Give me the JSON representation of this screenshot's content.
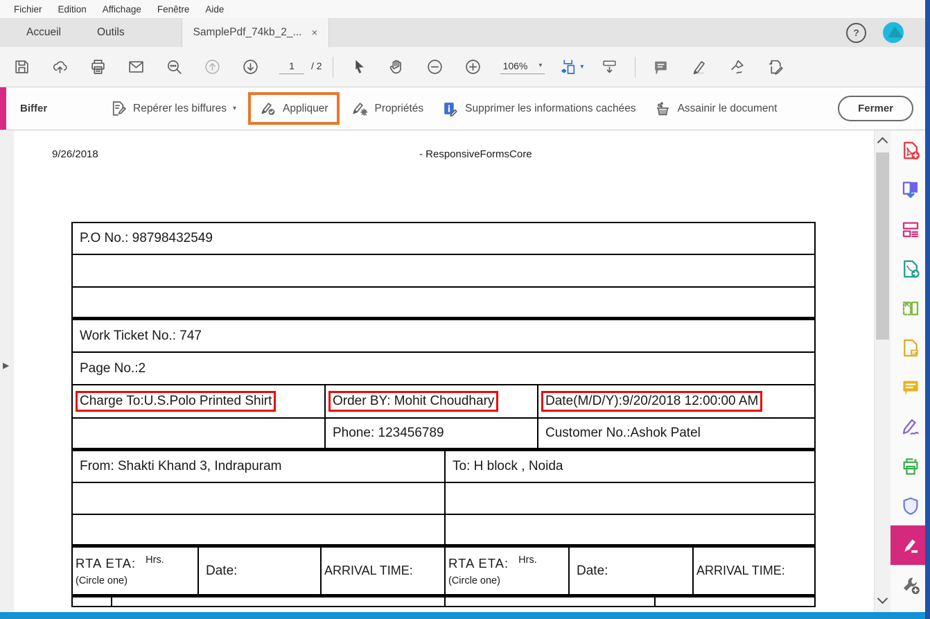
{
  "menu_bar": {
    "items": [
      "Fichier",
      "Edition",
      "Affichage",
      "Fenêtre",
      "Aide"
    ]
  },
  "tab_bar": {
    "tabs": [
      {
        "label": "Accueil"
      },
      {
        "label": "Outils"
      },
      {
        "label": "SamplePdf_74kb_2_...",
        "active": true
      }
    ],
    "close_glyph": "×",
    "help_glyph": "?"
  },
  "toolbar": {
    "page_current": "1",
    "page_separator": "/ 2",
    "zoom_value": "106%"
  },
  "redact_bar": {
    "title": "Biffer",
    "mark_label": "Repérer les biffures",
    "apply_label": "Appliquer",
    "properties_label": "Propriétés",
    "remove_hidden_label": "Supprimer les informations cachées",
    "sanitize_label": "Assainir le document",
    "close_button": "Fermer"
  },
  "document": {
    "date_header": "9/26/2018",
    "title_header": "- ResponsiveFormsCore",
    "table": {
      "po_no": "P.O No.: 98798432549",
      "work_ticket": "Work Ticket No.: 747",
      "page_no": "Page No.:2",
      "charge_to": "Charge To:U.S.Polo Printed Shirt",
      "order_by": "Order BY: Mohit Choudhary",
      "date_field": "Date(M/D/Y):9/20/2018 12:00:00 AM",
      "phone": "Phone: 123456789",
      "customer_no": "Customer No.:Ashok Patel",
      "from": "From: Shakti Khand 3, Indrapuram",
      "to": "To: H block , Noida",
      "rta_eta": "RTA  ETA:",
      "hrs": "Hrs.",
      "circle_one": "(Circle one)",
      "date_label": "Date:",
      "arrival_time": "ARRIVAL TIME:"
    }
  },
  "right_rail": {
    "tools": [
      "create-pdf",
      "export-pdf",
      "edit-pdf",
      "convert-pdf",
      "organize-pages",
      "request-signatures",
      "comment",
      "fill-sign",
      "print-production",
      "protect",
      "redact",
      "more-tools"
    ],
    "selected_tool": "redact"
  },
  "icons": {
    "caret_down": "▾",
    "triangle_right": "▶"
  },
  "colors": {
    "redact_accent_pink": "#d52b80",
    "apply_highlight_orange": "#e8782c",
    "redaction_mark_red": "#e80b0b",
    "window_right_border_blue": "#2052a8",
    "window_bottom_border_blue": "#1193d6",
    "avatar_cyan": "#1fb9de",
    "selected_tool_pink": "#d5297d"
  }
}
